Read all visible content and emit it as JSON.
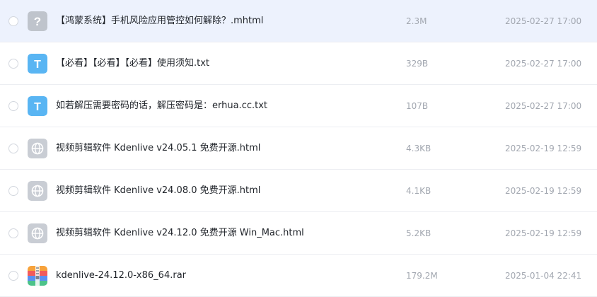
{
  "colors": {
    "selected_row_bg": "#edf2fd",
    "text_icon_bg": "#59b5f3",
    "unknown_icon_bg": "#bfc4cc",
    "web_icon_bg": "#c9cdd4",
    "secondary_text": "#a2a7b0"
  },
  "files": [
    {
      "name": "【鸿蒙系统】手机风险应用管控如何解除？.mhtml",
      "size": "2.3M",
      "date": "2025-02-27 17:00",
      "icon": "unknown-file-icon",
      "selected": true
    },
    {
      "name": "【必看】【必看】【必看】使用须知.txt",
      "size": "329B",
      "date": "2025-02-27 17:00",
      "icon": "text-file-icon",
      "selected": false
    },
    {
      "name": "如若解压需要密码的话，解压密码是：erhua.cc.txt",
      "size": "107B",
      "date": "2025-02-27 17:00",
      "icon": "text-file-icon",
      "selected": false
    },
    {
      "name": "视频剪辑软件 Kdenlive v24.05.1 免费开源.html",
      "size": "4.3KB",
      "date": "2025-02-19 12:59",
      "icon": "web-file-icon",
      "selected": false
    },
    {
      "name": "视频剪辑软件 Kdenlive v24.08.0 免费开源.html",
      "size": "4.1KB",
      "date": "2025-02-19 12:59",
      "icon": "web-file-icon",
      "selected": false
    },
    {
      "name": "视频剪辑软件 Kdenlive v24.12.0 免费开源 Win_Mac.html",
      "size": "5.2KB",
      "date": "2025-02-19 12:59",
      "icon": "web-file-icon",
      "selected": false
    },
    {
      "name": "kdenlive-24.12.0-x86_64.rar",
      "size": "179.2M",
      "date": "2025-01-04 22:41",
      "icon": "archive-file-icon",
      "selected": false
    }
  ]
}
